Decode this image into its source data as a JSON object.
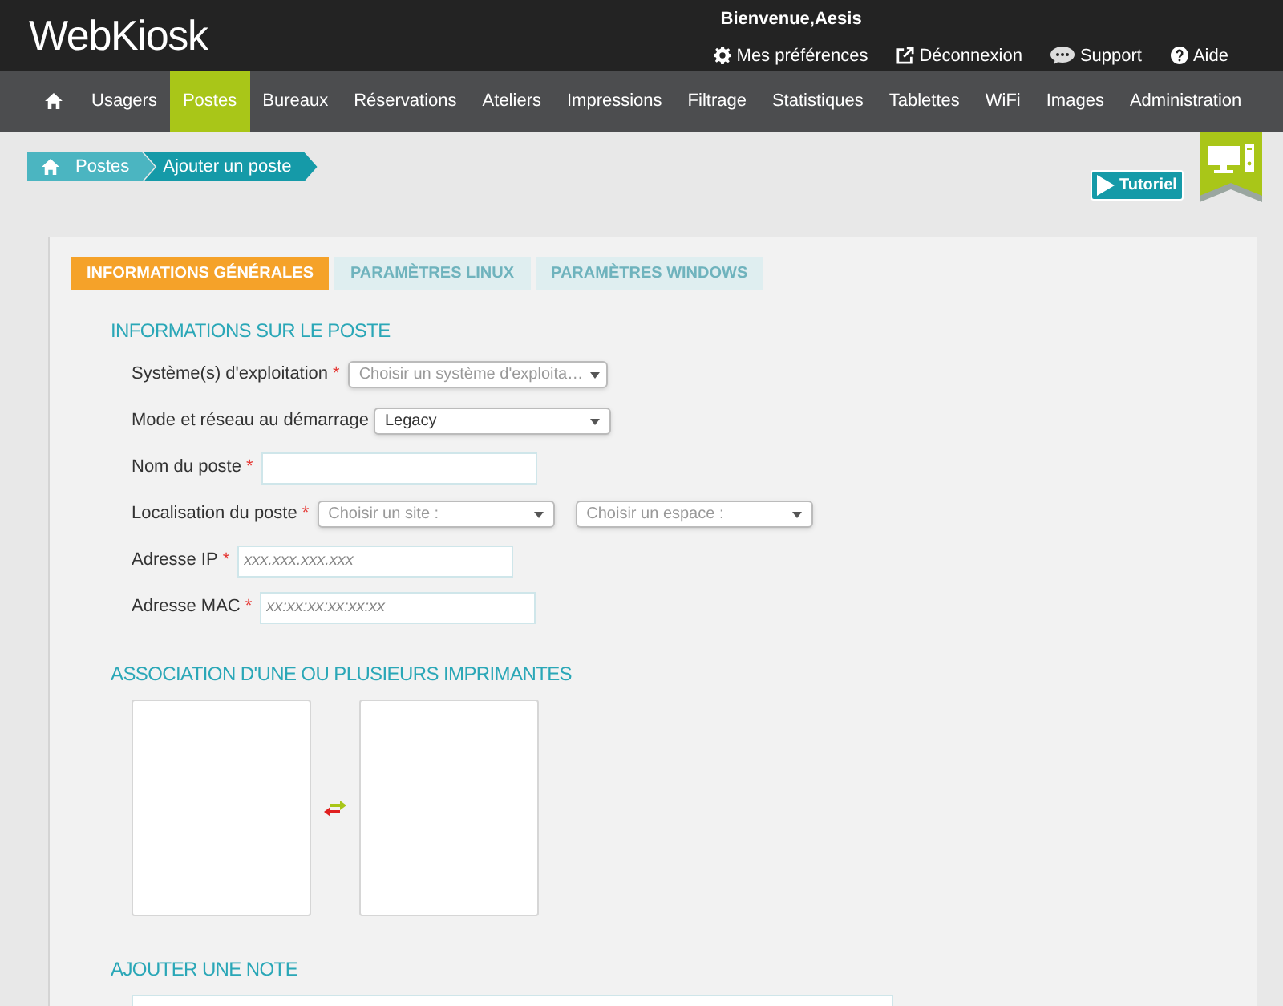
{
  "header": {
    "logo": "WebKiosk",
    "welcome": "Bienvenue,Aesis",
    "links": [
      {
        "kind": "gear",
        "label": "Mes préférences"
      },
      {
        "kind": "external",
        "label": "Déconnexion"
      },
      {
        "kind": "chat",
        "label": "Support"
      },
      {
        "kind": "help",
        "label": "Aide"
      }
    ]
  },
  "nav": [
    {
      "label": "Usagers",
      "selected": false
    },
    {
      "label": "Postes",
      "selected": true
    },
    {
      "label": "Bureaux",
      "selected": false
    },
    {
      "label": "Réservations",
      "selected": false
    },
    {
      "label": "Ateliers",
      "selected": false
    },
    {
      "label": "Impressions",
      "selected": false
    },
    {
      "label": "Filtrage",
      "selected": false
    },
    {
      "label": "Statistiques",
      "selected": false
    },
    {
      "label": "Tablettes",
      "selected": false
    },
    {
      "label": "WiFi",
      "selected": false
    },
    {
      "label": "Images",
      "selected": false
    },
    {
      "label": "Administration",
      "selected": false
    }
  ],
  "breadcrumb": [
    "Postes",
    "Ajouter un poste"
  ],
  "tutorial_button": "Tutoriel",
  "tabs": [
    {
      "label": "INFORMATIONS GÉNÉRALES",
      "selected": true
    },
    {
      "label": "PARAMÈTRES LINUX",
      "selected": false
    },
    {
      "label": "PARAMÈTRES WINDOWS",
      "selected": false
    }
  ],
  "section_info": "INFORMATIONS SUR LE POSTE",
  "fields": [
    {
      "label": "Système(s) d'exploitation",
      "required_mark": "*",
      "controls": [
        {
          "kind": "select",
          "placeholder": "Choisir un système d'exploita…"
        }
      ]
    },
    {
      "label": "Mode et réseau au démarrage",
      "controls": [
        {
          "kind": "select",
          "value": "Legacy"
        }
      ]
    },
    {
      "label": "Nom du poste",
      "required_mark": "*",
      "controls": [
        {
          "kind": "text"
        }
      ]
    },
    {
      "label": "Localisation du poste",
      "required_mark": "*",
      "controls": [
        {
          "kind": "select",
          "placeholder": "Choisir un site :"
        },
        {
          "kind": "select",
          "placeholder": "Choisir un espace :"
        }
      ]
    },
    {
      "label": "Adresse IP",
      "required_mark": "*",
      "controls": [
        {
          "kind": "text",
          "placeholder": "xxx.xxx.xxx.xxx"
        }
      ]
    },
    {
      "label": "Adresse MAC",
      "required_mark": "*",
      "controls": [
        {
          "kind": "text",
          "placeholder": "xx:xx:xx:xx:xx:xx"
        }
      ]
    }
  ],
  "section_printers": "ASSOCIATION D'UNE OU PLUSIEURS IMPRIMANTES",
  "section_note": "AJOUTER UNE NOTE"
}
